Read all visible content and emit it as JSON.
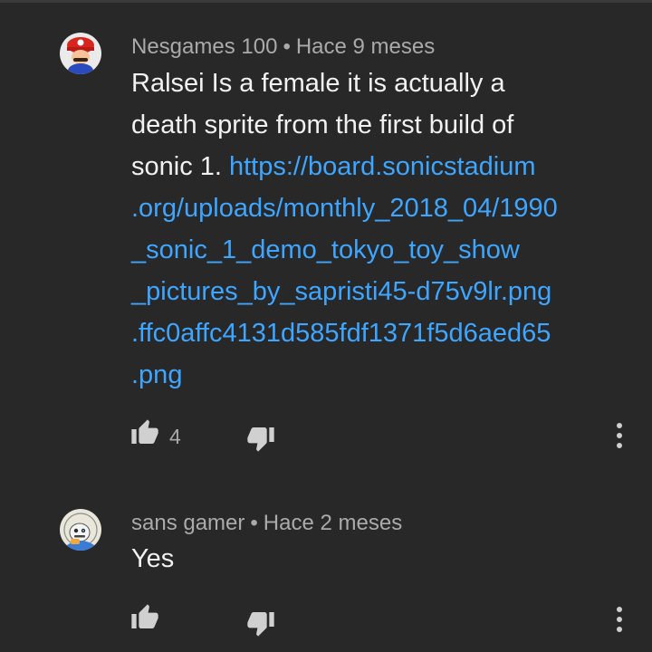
{
  "comments": [
    {
      "author": "Nesgames 100",
      "time": "Hace 9 meses",
      "text_lines": [
        "Ralsei Is a female it is actually a",
        "death sprite from the first build of"
      ],
      "text_prefix": "sonic 1. ",
      "link_first": "https://board.sonicstadium",
      "link_lines": [
        ".org/uploads/monthly_2018_04/1990",
        "_sonic_1_demo_tokyo_toy_show",
        "_pictures_by_sapristi45-d75v9lr.png",
        ".ffc0affc4131d585fdf1371f5d6aed65",
        ".png"
      ],
      "likes": "4"
    },
    {
      "author": "sans gamer",
      "time": "Hace 2 meses",
      "text": "Yes"
    }
  ],
  "separator": "•",
  "colors": {
    "background": "#282828",
    "text": "#f1f1f1",
    "meta": "#aaaaaa",
    "link": "#3ea6ff",
    "icon": "#d0d0d0"
  },
  "icons": {
    "like": "thumb-up-icon",
    "dislike": "thumb-down-icon",
    "more": "more-vert-icon"
  }
}
